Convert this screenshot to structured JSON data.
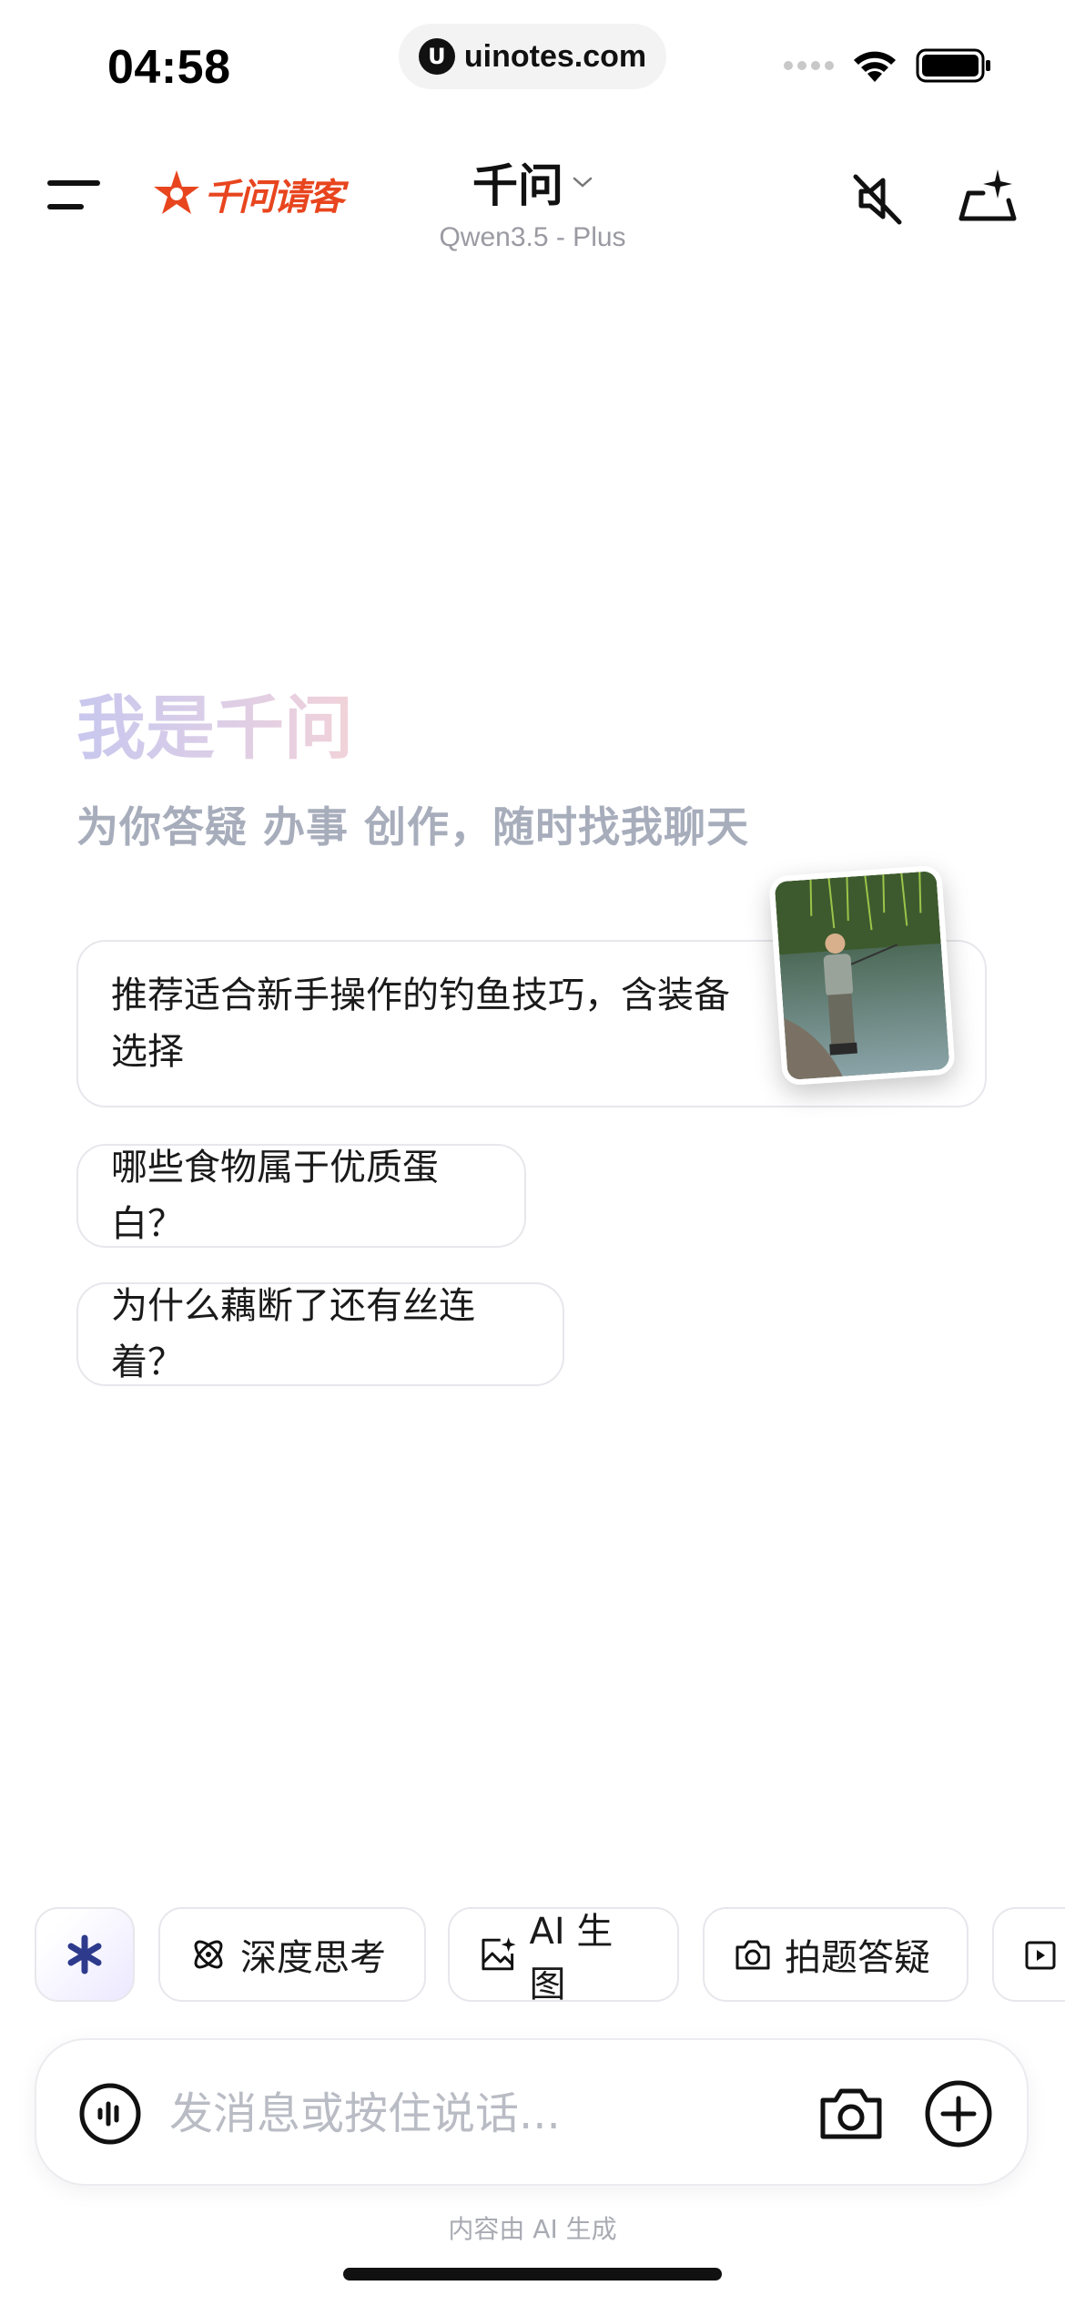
{
  "status_bar": {
    "time": "04:58",
    "url": "uinotes.com"
  },
  "header": {
    "brand_name": "千问请客",
    "model_name": "千问",
    "model_version": "Qwen3.5 - Plus"
  },
  "greeting": {
    "title": "我是千问",
    "subtitle": "为你答疑 办事 创作，随时找我聊天"
  },
  "suggestions": [
    {
      "text": "推荐适合新手操作的钓鱼技巧，含装备选择"
    },
    {
      "text": "哪些食物属于优质蛋白？"
    },
    {
      "text": "为什么藕断了还有丝连着？"
    }
  ],
  "toolbar": {
    "chips": [
      {
        "label": "深度思考",
        "icon": "atom-icon"
      },
      {
        "label": "AI 生图",
        "icon": "image-sparkle-icon"
      },
      {
        "label": "拍题答疑",
        "icon": "camera-icon"
      }
    ]
  },
  "input": {
    "placeholder": "发消息或按住说话..."
  },
  "footer": {
    "disclaimer": "内容由 AI 生成"
  },
  "colors": {
    "brand": "#e8451e",
    "accent": "#3b3f8f",
    "muted": "#a7adbb"
  }
}
